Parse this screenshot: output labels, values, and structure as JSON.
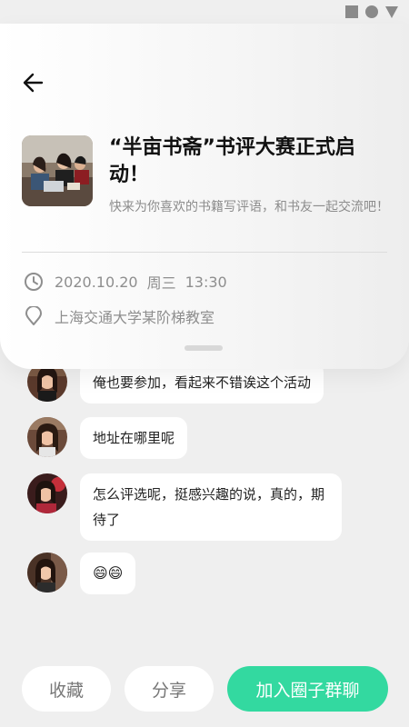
{
  "event": {
    "title": "“半亩书斋”书评大赛正式启动！",
    "subtitle": "快来为你喜欢的书籍写评语，和书友一起交流吧！",
    "date": "2020.10.20",
    "weekday": "周三",
    "time": "13:30",
    "location": "上海交通大学某阶梯教室"
  },
  "icons": {
    "back": "arrow-left-icon",
    "clock": "clock-icon",
    "location": "location-pin-icon",
    "status": [
      "square-icon",
      "circle-icon",
      "triangle-icon"
    ]
  },
  "messages": [
    {
      "text": "俺也要参加，看起来不错诶这个活动"
    },
    {
      "text": "地址在哪里呢"
    },
    {
      "text": "怎么评选呢，挺感兴趣的说，真的，期待了"
    },
    {
      "text": "😄😄"
    }
  ],
  "actions": {
    "favorite": "收藏",
    "share": "分享",
    "join": "加入圈子群聊"
  },
  "colors": {
    "accent": "#33d9a0",
    "background": "#efefef"
  }
}
